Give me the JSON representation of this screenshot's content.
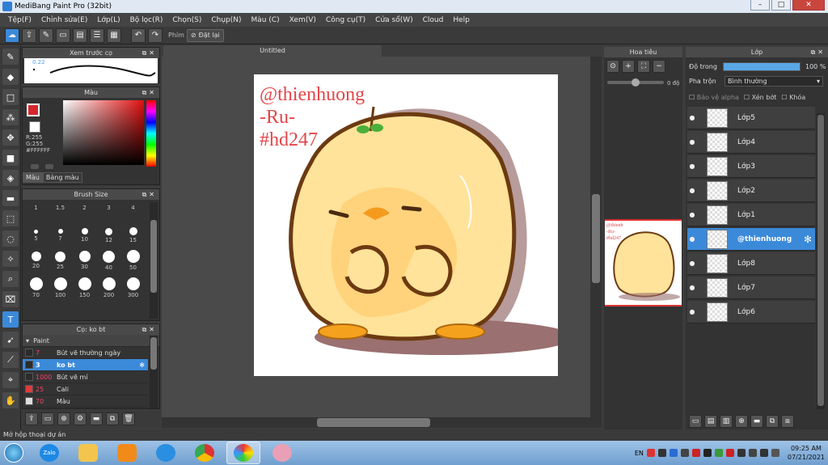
{
  "window": {
    "title": "MediBang Paint Pro (32bit)"
  },
  "menu": [
    "Tệp(F)",
    "Chỉnh sửa(E)",
    "Lớp(L)",
    "Bộ lọc(R)",
    "Chọn(S)",
    "Chụp(N)",
    "Màu (C)",
    "Xem(V)",
    "Công cụ(T)",
    "Cửa sổ(W)",
    "Cloud",
    "Help"
  ],
  "toolbar": {
    "hint": "Phím",
    "reset_label": "Đặt lại"
  },
  "preview_panel": {
    "title": "Xem trước cọ",
    "value": "0.22"
  },
  "color_panel": {
    "title": "Màu",
    "r": "R:255",
    "g": "G:255",
    "hex": "#FFFFFF",
    "tab_color": "Màu",
    "tab_palette": "Bảng màu"
  },
  "brush_size_panel": {
    "title": "Brush Size",
    "rows": [
      [
        "1",
        "1.5",
        "2",
        "3",
        "4"
      ],
      [
        "5",
        "7",
        "10",
        "12",
        "15"
      ],
      [
        "20",
        "25",
        "30",
        "40",
        "50"
      ],
      [
        "70",
        "100",
        "150",
        "200",
        "300"
      ]
    ]
  },
  "brush_panel": {
    "title": "Cọ: ko bt",
    "group": "Paint",
    "items": [
      {
        "num": "7",
        "name": "Bút vẽ thường ngày",
        "color": "#2b2b2b",
        "sel": false
      },
      {
        "num": "3",
        "name": "ko bt",
        "color": "#2b2b2b",
        "sel": true
      },
      {
        "num": "1000",
        "name": "Bút vẽ mí",
        "color": "#2b2b2b",
        "sel": false
      },
      {
        "num": "25",
        "name": "Cali",
        "color": "#e03a3a",
        "sel": false
      },
      {
        "num": "70",
        "name": "Màu",
        "color": "#dddddd",
        "sel": false
      }
    ]
  },
  "canvas": {
    "tab": "Untitled",
    "watermark": [
      "@thienhuong",
      "-Ru-",
      "#hd247"
    ]
  },
  "navigator": {
    "title": "Hoa tiêu",
    "angle": "0 độ",
    "thumb_text": [
      "@thienh",
      "-Ru-",
      "#hd247"
    ]
  },
  "layers_panel": {
    "title": "Lớp",
    "opacity_label": "Độ trong",
    "opacity_value": "100 %",
    "opacity": 1.0,
    "blend_label": "Pha trộn",
    "blend_value": "Bình thường",
    "protect_alpha": "Bảo vệ alpha",
    "clip": "Xén bớt",
    "lock": "Khóa",
    "layers": [
      {
        "name": "Lớp5",
        "sel": false
      },
      {
        "name": "Lớp4",
        "sel": false
      },
      {
        "name": "Lớp3",
        "sel": false
      },
      {
        "name": "Lớp2",
        "sel": false
      },
      {
        "name": "Lớp1",
        "sel": false
      },
      {
        "name": "@thienhuong",
        "sel": true
      },
      {
        "name": "Lớp8",
        "sel": false
      },
      {
        "name": "Lớp7",
        "sel": false
      },
      {
        "name": "Lớp6",
        "sel": false
      }
    ]
  },
  "status": {
    "text": "Mở hộp thoại dự án"
  },
  "taskbar": {
    "zalo": "Zalo",
    "lang": "EN",
    "time": "09:25 AM",
    "date": "07/21/2021"
  },
  "colors": {
    "accent": "#3b8ad9",
    "bg": "#3c3c3c",
    "watermark": "#e4454a"
  }
}
